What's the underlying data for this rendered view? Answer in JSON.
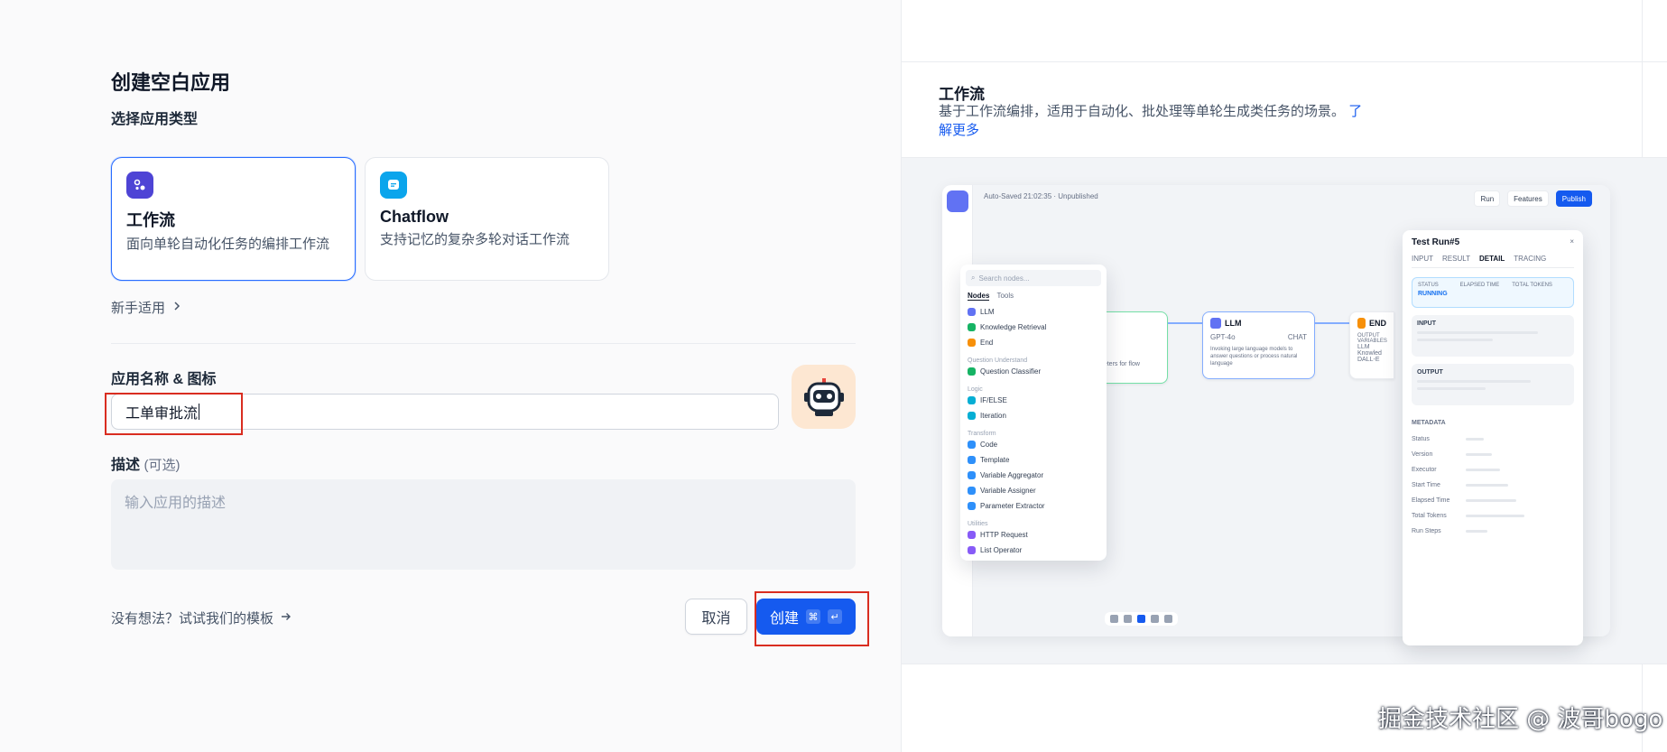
{
  "page_title": "创建空白应用",
  "app_type_section": {
    "label": "选择应用类型",
    "cards": [
      {
        "name": "工作流",
        "desc": "面向单轮自动化任务的编排工作流",
        "selected": true,
        "icon": "workflow-icon",
        "icon_color": "#4e44d5"
      },
      {
        "name": "Chatflow",
        "desc": "支持记忆的复杂多轮对话工作流",
        "selected": false,
        "icon": "chatflow-icon",
        "icon_color": "#0ba5ec"
      }
    ],
    "beginner_link": "新手适用"
  },
  "name_section": {
    "label": "应用名称 & 图标",
    "value": "工单审批流",
    "avatar_icon": "robot-icon"
  },
  "desc_section": {
    "label": "描述",
    "optional": "(可选)",
    "placeholder": "输入应用的描述"
  },
  "footer": {
    "template_link": "没有想法？试试我们的模板",
    "cancel_label": "取消",
    "create_label": "创建",
    "shortcut_cmd": "⌘",
    "shortcut_enter": "↵"
  },
  "preview": {
    "title": "工作流",
    "desc": "基于工作流编排，适用于自动化、批处理等单轮生成类任务的场景。",
    "learn_more": "了解更多",
    "mock": {
      "autosave": "Auto-Saved 21:02:35 · Unpublished",
      "run": "Run",
      "features": "Features",
      "publish": "Publish",
      "search_placeholder": "Search nodes...",
      "tab_nodes": "Nodes",
      "tab_tools": "Tools",
      "menu": [
        {
          "type": "item",
          "label": "LLM",
          "color": "#6172f3"
        },
        {
          "type": "item",
          "label": "Knowledge Retrieval",
          "color": "#16b364"
        },
        {
          "type": "item",
          "label": "End",
          "color": "#f79009"
        },
        {
          "type": "group",
          "label": "Question Understand"
        },
        {
          "type": "item",
          "label": "Question Classifier",
          "color": "#16b364"
        },
        {
          "type": "group",
          "label": "Logic"
        },
        {
          "type": "item",
          "label": "IF/ELSE",
          "color": "#06aed4"
        },
        {
          "type": "item",
          "label": "Iteration",
          "color": "#06aed4"
        },
        {
          "type": "group",
          "label": "Transform"
        },
        {
          "type": "item",
          "label": "Code",
          "color": "#2e90fa"
        },
        {
          "type": "item",
          "label": "Template",
          "color": "#2e90fa"
        },
        {
          "type": "item",
          "label": "Variable Aggregator",
          "color": "#2e90fa"
        },
        {
          "type": "item",
          "label": "Variable Assigner",
          "color": "#2e90fa"
        },
        {
          "type": "item",
          "label": "Parameter Extractor",
          "color": "#2e90fa"
        },
        {
          "type": "group",
          "label": "Utilities"
        },
        {
          "type": "item",
          "label": "HTTP Request",
          "color": "#875bf7"
        },
        {
          "type": "item",
          "label": "List Operator",
          "color": "#875bf7"
        }
      ],
      "llm_node": {
        "title": "LLM",
        "model": "GPT-4o",
        "badge": "CHAT",
        "desc": "Invoking large language models to answer questions or process natural language"
      },
      "end_node": {
        "title": "END",
        "output_label": "OUTPUT VARIABLES",
        "vars": [
          "LLM",
          "Knowled",
          "DALL-E"
        ]
      },
      "start_node_text": "parameters for flow",
      "run_panel": {
        "title": "Test Run#5",
        "tabs": [
          "INPUT",
          "RESULT",
          "DETAIL",
          "TRACING"
        ],
        "status_label": "STATUS",
        "status_value": "RUNNING",
        "elapsed_label": "ELAPSED TIME",
        "tokens_label": "TOTAL TOKENS",
        "input_label": "INPUT",
        "output_label": "OUTPUT",
        "metadata_label": "METADATA",
        "meta_rows": [
          "Status",
          "Version",
          "Executor",
          "Start Time",
          "Elapsed Time",
          "Total Tokens",
          "Run Steps"
        ]
      }
    }
  },
  "watermark": "掘金技术社区 @ 波哥bogo"
}
